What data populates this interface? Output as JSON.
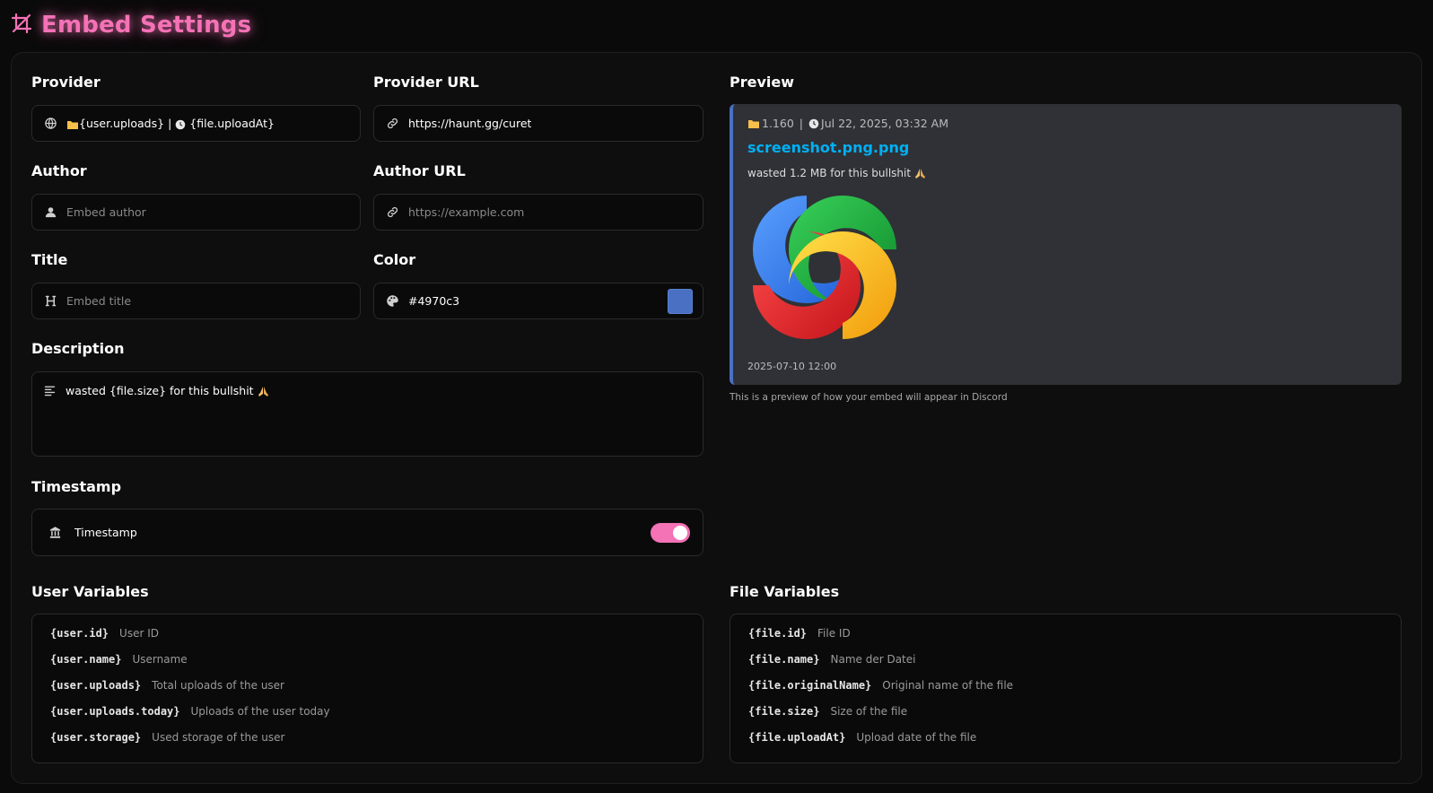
{
  "header": {
    "title": "Embed Settings"
  },
  "form": {
    "provider": {
      "label": "Provider",
      "value_part1": "{user.uploads}",
      "separator": "|",
      "value_part2": "{file.uploadAt}"
    },
    "provider_url": {
      "label": "Provider URL",
      "value": "https://haunt.gg/curet"
    },
    "author": {
      "label": "Author",
      "placeholder": "Embed author"
    },
    "author_url": {
      "label": "Author URL",
      "placeholder": "https://example.com"
    },
    "title": {
      "label": "Title",
      "placeholder": "Embed title"
    },
    "color": {
      "label": "Color",
      "value": "#4970c3"
    },
    "description": {
      "label": "Description",
      "value": "wasted {file.size} for this bullshit"
    },
    "timestamp": {
      "section_label": "Timestamp",
      "toggle_label": "Timestamp",
      "enabled": true
    }
  },
  "preview": {
    "label": "Preview",
    "provider_count": "1.160",
    "provider_separator": "|",
    "provider_date": "Jul 22, 2025, 03:32 AM",
    "title": "screenshot.png.png",
    "description": "wasted 1.2 MB for this bullshit",
    "footer": "2025-07-10 12:00",
    "note": "This is a preview of how your embed will appear in Discord",
    "embed_color": "#4970c3"
  },
  "user_variables": {
    "label": "User Variables",
    "items": [
      {
        "code": "{user.id}",
        "desc": "User ID"
      },
      {
        "code": "{user.name}",
        "desc": "Username"
      },
      {
        "code": "{user.uploads}",
        "desc": "Total uploads of the user"
      },
      {
        "code": "{user.uploads.today}",
        "desc": "Uploads of the user today"
      },
      {
        "code": "{user.storage}",
        "desc": "Used storage of the user"
      }
    ]
  },
  "file_variables": {
    "label": "File Variables",
    "items": [
      {
        "code": "{file.id}",
        "desc": "File ID"
      },
      {
        "code": "{file.name}",
        "desc": "Name der Datei"
      },
      {
        "code": "{file.originalName}",
        "desc": "Original name of the file"
      },
      {
        "code": "{file.size}",
        "desc": "Size of the file"
      },
      {
        "code": "{file.uploadAt}",
        "desc": "Upload date of the file"
      }
    ]
  },
  "colors": {
    "accent": "#f472b6",
    "background": "#0a0a0a",
    "preview_bg": "#2f3136",
    "link": "#00b0f4"
  },
  "icons": [
    "crop-icon",
    "globe-icon",
    "link-icon",
    "user-icon",
    "heading-icon",
    "palette-icon",
    "align-left-icon",
    "building-icon",
    "folder-icon",
    "clock-icon",
    "praying-hands-icon",
    "sharex-logo-image"
  ]
}
